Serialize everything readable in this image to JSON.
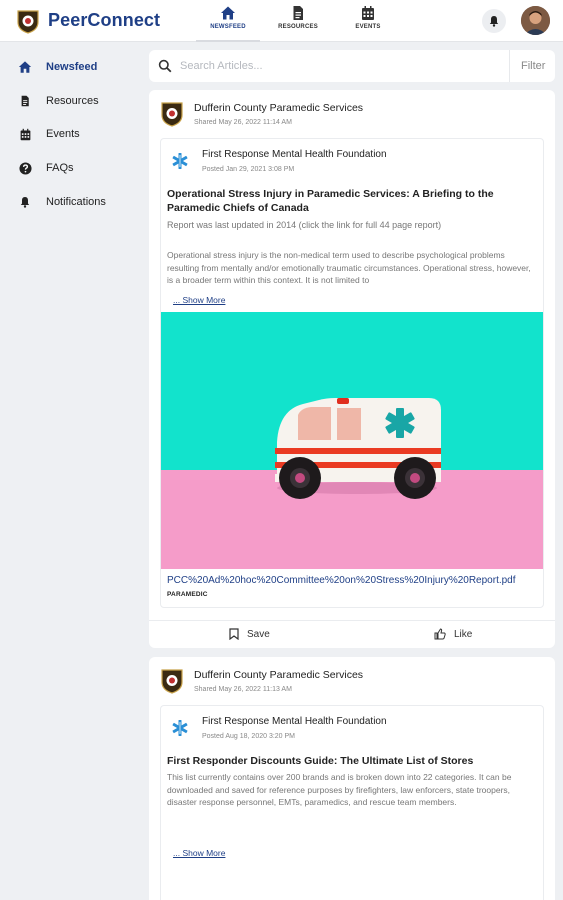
{
  "header": {
    "brand": "PeerConnect",
    "nav": [
      {
        "label": "NEWSFEED",
        "icon": "home-icon",
        "active": true
      },
      {
        "label": "RESOURCES",
        "icon": "document-icon",
        "active": false
      },
      {
        "label": "EVENTS",
        "icon": "calendar-icon",
        "active": false
      }
    ]
  },
  "sidebar": {
    "items": [
      {
        "label": "Newsfeed",
        "icon": "home-icon",
        "active": true
      },
      {
        "label": "Resources",
        "icon": "document-icon",
        "active": false
      },
      {
        "label": "Events",
        "icon": "calendar-icon",
        "active": false
      },
      {
        "label": "FAQs",
        "icon": "question-icon",
        "active": false
      },
      {
        "label": "Notifications",
        "icon": "bell-icon",
        "active": false
      }
    ]
  },
  "search": {
    "placeholder": "Search Articles...",
    "filter_label": "Filter"
  },
  "posts": [
    {
      "org": "Dufferin County Paramedic Services",
      "shared": "Shared May 26, 2022 11:14 AM",
      "source": "First Response Mental Health Foundation",
      "posted": "Posted Jan 29, 2021 3:08 PM",
      "title": "Operational Stress Injury in Paramedic Services: A Briefing to the Paramedic Chiefs of Canada",
      "subtitle": "Report was last updated in 2014 (click the link for full 44 page report)",
      "description": "Operational stress injury is the non-medical term used to describe psychological problems resulting from mentally and/or emotionally traumatic circumstances. Operational stress, however, is a broader term within this context. It is not limited to",
      "show_more": "... Show More",
      "link": "PCC%20Ad%20hoc%20Committee%20on%20Stress%20Injury%20Report.pdf",
      "tag": "PARAMEDIC",
      "save_label": "Save",
      "like_label": "Like"
    },
    {
      "org": "Dufferin County Paramedic Services",
      "shared": "Shared May 26, 2022 11:13 AM",
      "source": "First Response Mental Health Foundation",
      "posted": "Posted Aug 18, 2020 3:20 PM",
      "title": "First Responder Discounts Guide: The Ultimate List of Stores",
      "description": "This list currently contains over 200 brands and is broken down into 22 categories. It can be downloaded and saved for reference purposes by firefighters, law enforcers, state troopers, disaster response personnel, EMTs, paramedics, and rescue team members.",
      "show_more": "... Show More"
    }
  ],
  "colors": {
    "brand": "#1f3f86",
    "background": "#eef0f3",
    "hero_teal": "#12e3cc",
    "hero_pink": "#f59cc9"
  }
}
